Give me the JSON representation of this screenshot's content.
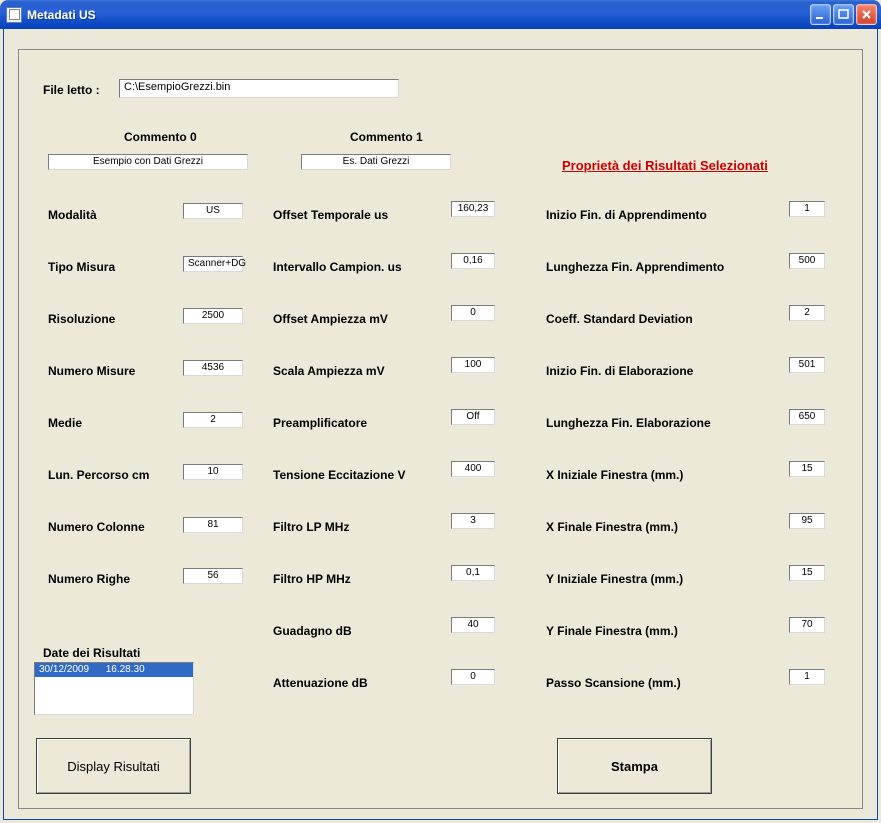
{
  "window": {
    "title": "Metadati US"
  },
  "file": {
    "label": "File letto :",
    "value": "C:\\EsempioGrezzi.bin"
  },
  "comments": {
    "header0": "Commento 0",
    "header1": "Commento 1",
    "value0": "Esempio con Dati Grezzi",
    "value1": "Es. Dati Grezzi"
  },
  "left": {
    "modalita": {
      "label": "Modalità",
      "value": "US"
    },
    "tipo_misura": {
      "label": "Tipo Misura",
      "value": "Scanner+DG"
    },
    "risoluzione": {
      "label": "Risoluzione",
      "value": "2500"
    },
    "numero_misure": {
      "label": "Numero Misure",
      "value": "4536"
    },
    "medie": {
      "label": "Medie",
      "value": "2"
    },
    "lun_percorso": {
      "label": "Lun. Percorso cm",
      "value": "10"
    },
    "numero_colonne": {
      "label": "Numero Colonne",
      "value": "81"
    },
    "numero_righe": {
      "label": "Numero Righe",
      "value": "56"
    }
  },
  "mid": {
    "offset_temporale": {
      "label": "Offset Temporale us",
      "value": "160,23"
    },
    "intervallo_campion": {
      "label": "Intervallo Campion. us",
      "value": "0,16"
    },
    "offset_ampiezza": {
      "label": "Offset Ampiezza mV",
      "value": "0"
    },
    "scala_ampiezza": {
      "label": "Scala Ampiezza mV",
      "value": "100"
    },
    "preamplificatore": {
      "label": "Preamplificatore",
      "value": "Off"
    },
    "tensione_eccitazione": {
      "label": "Tensione Eccitazione V",
      "value": "400"
    },
    "filtro_lp": {
      "label": "Filtro LP MHz",
      "value": "3"
    },
    "filtro_hp": {
      "label": "Filtro HP MHz",
      "value": "0,1"
    },
    "guadagno": {
      "label": "Guadagno dB",
      "value": "40"
    },
    "attenuazione": {
      "label": "Attenuazione dB",
      "value": "0"
    }
  },
  "right": {
    "title": "Proprietà dei Risultati Selezionati",
    "inizio_apprendimento": {
      "label": "Inizio Fin. di Apprendimento",
      "value": "1"
    },
    "lunghezza_apprendimento": {
      "label": "Lunghezza Fin. Apprendimento",
      "value": "500"
    },
    "coeff_std_dev": {
      "label": "Coeff. Standard Deviation",
      "value": "2"
    },
    "inizio_elaborazione": {
      "label": "Inizio Fin. di Elaborazione",
      "value": "501"
    },
    "lunghezza_elaborazione": {
      "label": "Lunghezza Fin. Elaborazione",
      "value": "650"
    },
    "x_iniziale": {
      "label": "X  Iniziale Finestra   (mm.)",
      "value": "15"
    },
    "x_finale": {
      "label": "X  Finale Finestra    (mm.)",
      "value": "95"
    },
    "y_iniziale": {
      "label": "Y  Iniziale Finestra   (mm.)",
      "value": "15"
    },
    "y_finale": {
      "label": "Y  Finale Finestra    (mm.)",
      "value": "70"
    },
    "passo_scansione": {
      "label": "Passo Scansione    (mm.)",
      "value": "1"
    }
  },
  "results": {
    "label": "Date dei Risultati",
    "items": [
      "30/12/2009      16.28.30"
    ]
  },
  "buttons": {
    "display": "Display Risultati",
    "stampa": "Stampa"
  }
}
